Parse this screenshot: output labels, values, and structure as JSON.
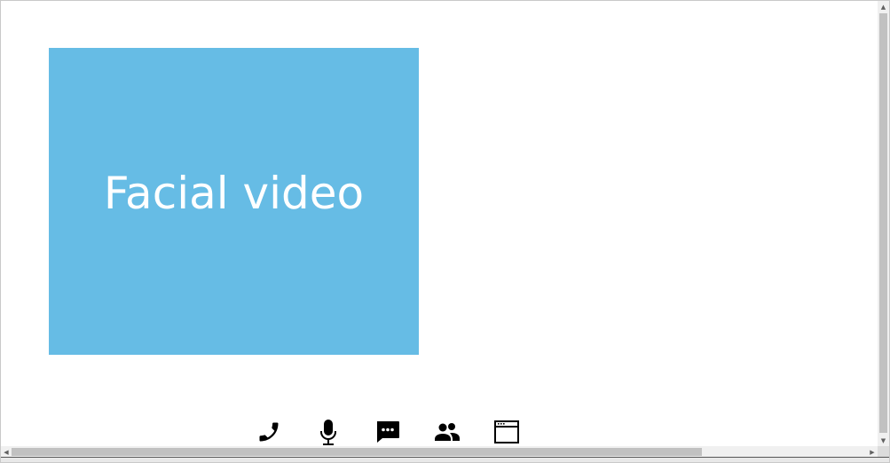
{
  "video_tile": {
    "label": "Facial video",
    "background_color": "#66bce5"
  },
  "toolbar": {
    "items": [
      {
        "id": "call",
        "icon": "phone-icon"
      },
      {
        "id": "microphone",
        "icon": "microphone-icon"
      },
      {
        "id": "chat",
        "icon": "chat-bubble-icon"
      },
      {
        "id": "participants",
        "icon": "people-icon"
      },
      {
        "id": "window",
        "icon": "browser-window-icon"
      }
    ]
  },
  "scrollbars": {
    "vertical": {
      "up_arrow": "▲",
      "down_arrow": "▼"
    },
    "horizontal": {
      "left_arrow": "◀",
      "right_arrow": "▶"
    }
  }
}
